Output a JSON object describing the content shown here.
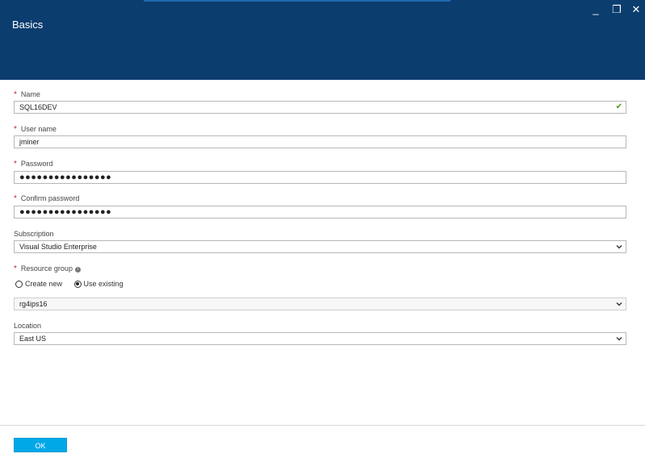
{
  "blade": {
    "title": "Basics",
    "window_controls": {
      "minimize": "_",
      "restore": "❐",
      "close": "✕"
    }
  },
  "form": {
    "name": {
      "label": "Name",
      "required": true,
      "value": "SQL16DEV",
      "valid": true
    },
    "user_name": {
      "label": "User name",
      "required": true,
      "value": "jminer"
    },
    "password": {
      "label": "Password",
      "required": true,
      "value": "●●●●●●●●●●●●●●●●"
    },
    "confirm_password": {
      "label": "Confirm password",
      "required": true,
      "value": "●●●●●●●●●●●●●●●●"
    },
    "subscription": {
      "label": "Subscription",
      "required": false,
      "value": "Visual Studio Enterprise"
    },
    "resource_group": {
      "label": "Resource group",
      "required": true,
      "options": [
        "Create new",
        "Use existing"
      ],
      "selected": "Use existing",
      "value": "rg4ips16"
    },
    "location": {
      "label": "Location",
      "required": false,
      "value": "East US"
    }
  },
  "required_marker": "*",
  "footer": {
    "ok_label": "OK"
  },
  "colors": {
    "header": "#0b3d6f",
    "required": "#c1272d",
    "ok_button": "#00a8e8",
    "valid": "#4f9a1a"
  },
  "icons": {
    "valid": "checkmark-icon",
    "dropdown": "chevron-down-icon",
    "info": "info-icon"
  }
}
